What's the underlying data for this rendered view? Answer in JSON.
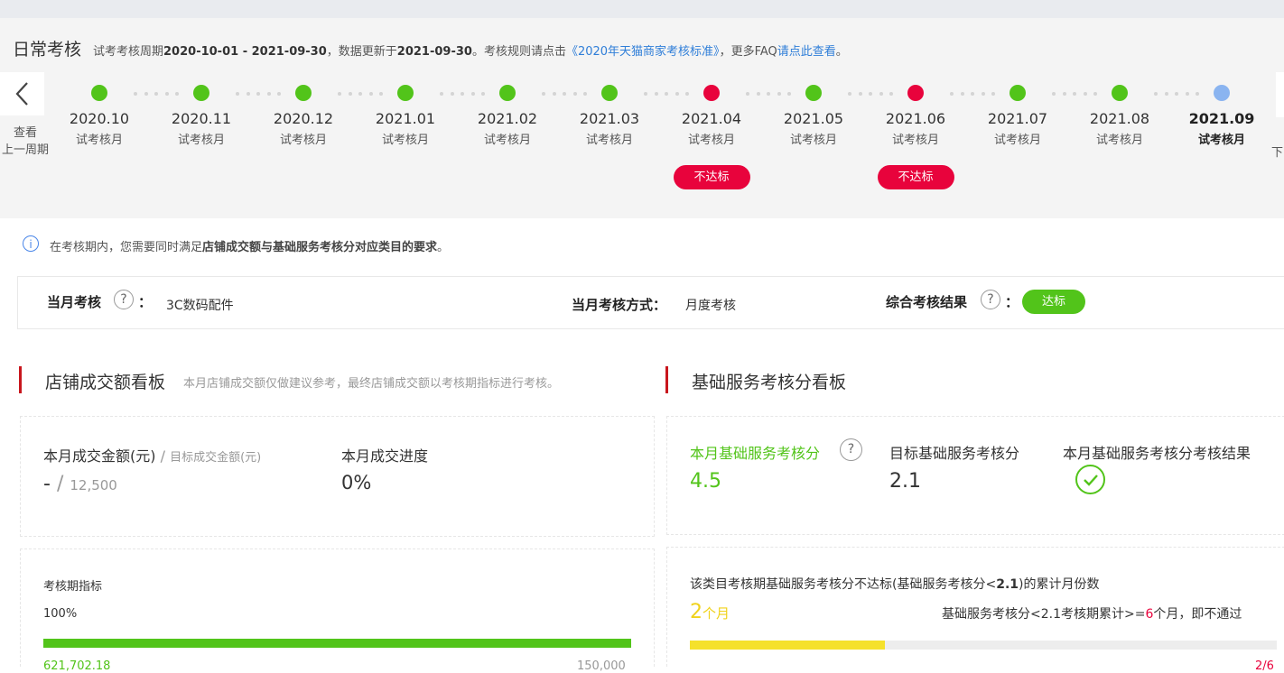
{
  "header": {
    "title": "日常考核",
    "sub_prefix": "试考考核周期",
    "period_range": "2020-10-01 - 2021-09-30",
    "sub_mid": "，数据更新于",
    "update_date": "2021-09-30",
    "sub_rule": "。考核规则请点击",
    "rule_link": "《2020年天猫商家考核标准》",
    "sub_faq": "，更多FAQ",
    "faq_link": "请点此查看",
    "sub_end": "。"
  },
  "nav": {
    "prev_line1": "查看",
    "prev_line2": "上一周期",
    "next_label": "下"
  },
  "colors": {
    "green": "#52c41a",
    "red": "#e8033c",
    "blue": "#8ab4f0",
    "accent_red": "#c8161d",
    "yellow": "#f5e12b"
  },
  "timeline": [
    {
      "month": "2020.10",
      "type": "试考核月",
      "status": "green",
      "badge": ""
    },
    {
      "month": "2020.11",
      "type": "试考核月",
      "status": "green",
      "badge": ""
    },
    {
      "month": "2020.12",
      "type": "试考核月",
      "status": "green",
      "badge": ""
    },
    {
      "month": "2021.01",
      "type": "试考核月",
      "status": "green",
      "badge": ""
    },
    {
      "month": "2021.02",
      "type": "试考核月",
      "status": "green",
      "badge": ""
    },
    {
      "month": "2021.03",
      "type": "试考核月",
      "status": "green",
      "badge": ""
    },
    {
      "month": "2021.04",
      "type": "试考核月",
      "status": "red",
      "badge": "不达标"
    },
    {
      "month": "2021.05",
      "type": "试考核月",
      "status": "green",
      "badge": ""
    },
    {
      "month": "2021.06",
      "type": "试考核月",
      "status": "red",
      "badge": "不达标"
    },
    {
      "month": "2021.07",
      "type": "试考核月",
      "status": "green",
      "badge": ""
    },
    {
      "month": "2021.08",
      "type": "试考核月",
      "status": "green",
      "badge": ""
    },
    {
      "month": "2021.09",
      "type": "试考核月",
      "status": "blue",
      "badge": "",
      "current": true
    }
  ],
  "notice": {
    "icon": "i",
    "prefix": "在考核期内，您需要同时满足",
    "bold": "店铺成交额与基础服务考核分对应类目的要求",
    "suffix": "。"
  },
  "summary": {
    "month_label": "当月考核",
    "colon": "：",
    "category": "3C数码配件",
    "method_label": "当月考核方式：",
    "method": "月度考核",
    "result_label": "综合考核结果",
    "result": "达标",
    "help": "?"
  },
  "store_panel": {
    "title": "店铺成交额看板",
    "note": "本月店铺成交额仅做建议参考，最终店铺成交额以考核期指标进行考核。",
    "amount_label": "本月成交金额(元)",
    "slash": " / ",
    "target_label": "目标成交金额(元)",
    "amount_value": "-",
    "target_value": "12,500",
    "progress_label": "本月成交进度",
    "progress_value": "0%",
    "period_label": "考核期指标",
    "period_percent": "100%",
    "period_progress": 1.0,
    "period_current": "621,702.18",
    "period_target": "150,000"
  },
  "service_panel": {
    "title": "基础服务考核分看板",
    "score_label": "本月基础服务考核分",
    "score_value": "4.5",
    "help": "?",
    "target_label": "目标基础服务考核分",
    "target_value": "2.1",
    "result_label": "本月基础服务考核分考核结果",
    "result_icon": "check-circle-icon",
    "accum_label": "该类目考核期基础服务考核分不达标(基础服务考核分<",
    "accum_bold": "2.1",
    "accum_suffix": ")的累计月份数",
    "accum_count": "2",
    "accum_unit": "个月",
    "rule_prefix": "基础服务考核分<2.1考核期累计>=",
    "rule_num": "6",
    "rule_suffix": "个月，即不通过",
    "accum_progress": 0.333,
    "accum_fraction": "2/6"
  }
}
